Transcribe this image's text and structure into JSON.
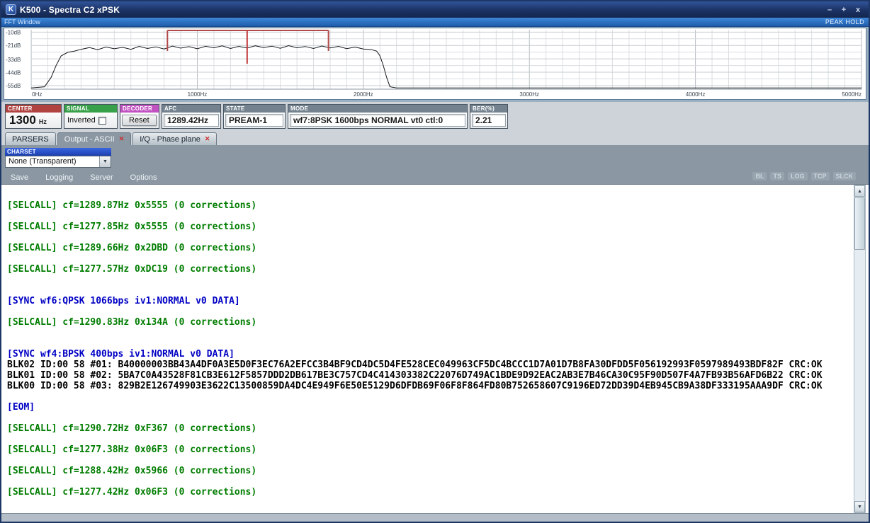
{
  "window": {
    "title": "K500 - Spectra C2 xPSK",
    "icon_letter": "K",
    "buttons": {
      "minimize": "–",
      "maximize": "+",
      "close": "x"
    }
  },
  "icons": {
    "tab_close": "✕",
    "dropdown_arrow": "▼",
    "scroll_up": "▲",
    "scroll_down": "▼"
  },
  "fft": {
    "header": "FFT Window",
    "peak_hold_label": "PEAK HOLD",
    "xlim_hz": [
      0,
      5000
    ],
    "ylim_db": [
      -58,
      -8
    ],
    "y_ticks": [
      [
        -10,
        "-10dB"
      ],
      [
        -21,
        "-21dB"
      ],
      [
        -33,
        "-33dB"
      ],
      [
        -44,
        "-44dB"
      ],
      [
        -55,
        "-55dB"
      ]
    ],
    "x_ticks": [
      [
        0,
        "0Hz"
      ],
      [
        1000,
        "1000Hz"
      ],
      [
        2000,
        "2000Hz"
      ],
      [
        3000,
        "3000Hz"
      ],
      [
        4000,
        "4000Hz"
      ],
      [
        5000,
        "5000Hz"
      ]
    ],
    "markers": {
      "band_start_hz": 820,
      "band_end_hz": 1790,
      "center_hz": 1300,
      "bracket_color": "#b24a4a",
      "center_color": "#c23b3b"
    },
    "spectrum_hz_db": [
      [
        0,
        -57
      ],
      [
        80,
        -56
      ],
      [
        120,
        -48
      ],
      [
        150,
        -38
      ],
      [
        180,
        -30
      ],
      [
        220,
        -27
      ],
      [
        260,
        -26
      ],
      [
        300,
        -24.5
      ],
      [
        350,
        -23
      ],
      [
        400,
        -24.8
      ],
      [
        450,
        -22.5
      ],
      [
        500,
        -24
      ],
      [
        550,
        -22.8
      ],
      [
        600,
        -24.5
      ],
      [
        650,
        -22
      ],
      [
        700,
        -23.8
      ],
      [
        750,
        -22.4
      ],
      [
        800,
        -24.2
      ],
      [
        850,
        -21.8
      ],
      [
        900,
        -23.5
      ],
      [
        950,
        -22.2
      ],
      [
        1000,
        -24
      ],
      [
        1050,
        -21.9
      ],
      [
        1100,
        -23.2
      ],
      [
        1150,
        -21.6
      ],
      [
        1200,
        -23.8
      ],
      [
        1250,
        -22
      ],
      [
        1300,
        -23.4
      ],
      [
        1350,
        -21.5
      ],
      [
        1400,
        -23
      ],
      [
        1450,
        -21.8
      ],
      [
        1500,
        -23.6
      ],
      [
        1550,
        -21.4
      ],
      [
        1600,
        -23.2
      ],
      [
        1650,
        -22.1
      ],
      [
        1700,
        -23.8
      ],
      [
        1750,
        -21.7
      ],
      [
        1800,
        -23.3
      ],
      [
        1850,
        -22
      ],
      [
        1900,
        -23.9
      ],
      [
        1950,
        -22.6
      ],
      [
        2000,
        -24.2
      ],
      [
        2050,
        -24.8
      ],
      [
        2080,
        -26
      ],
      [
        2100,
        -30
      ],
      [
        2120,
        -38
      ],
      [
        2140,
        -48
      ],
      [
        2160,
        -56
      ],
      [
        2200,
        -57
      ],
      [
        2600,
        -57
      ],
      [
        3000,
        -57
      ],
      [
        3400,
        -57
      ],
      [
        3800,
        -57
      ],
      [
        4200,
        -57
      ],
      [
        4600,
        -57
      ],
      [
        5000,
        -57
      ]
    ]
  },
  "controls": {
    "center": {
      "label": "CENTER",
      "value": "1300",
      "unit": "Hz"
    },
    "signal": {
      "label": "SIGNAL",
      "checkbox_label": "Inverted",
      "checked": false
    },
    "decoder": {
      "label": "DECODER",
      "button_label": "Reset"
    },
    "afc": {
      "label": "AFC",
      "value": "1289.42Hz"
    },
    "state": {
      "label": "STATE",
      "value": "PREAM-1"
    },
    "mode": {
      "label": "MODE",
      "value": "wf7:8PSK 1600bps NORMAL vt0 ctl:0"
    },
    "ber": {
      "label": "BER(%)",
      "value": "2.21"
    }
  },
  "tabs": [
    {
      "label": "PARSERS",
      "closable": false,
      "active": false
    },
    {
      "label": "Output - ASCII",
      "closable": true,
      "active": true
    },
    {
      "label": "I/Q - Phase plane",
      "closable": true,
      "active": false
    }
  ],
  "charset": {
    "label": "CHARSET",
    "selected": "None (Transparent)"
  },
  "menu": {
    "items": [
      "Save",
      "Logging",
      "Server",
      "Options"
    ]
  },
  "status_flags": [
    "BL",
    "TS",
    "LOG",
    "TCP",
    "SLCK"
  ],
  "output": {
    "lines": [
      {
        "text": "[SELCALL] cf=1289.87Hz 0x5555 (0 corrections)",
        "color": "green"
      },
      {
        "text": "",
        "color": "black"
      },
      {
        "text": "[SELCALL] cf=1277.85Hz 0x5555 (0 corrections)",
        "color": "green"
      },
      {
        "text": "",
        "color": "black"
      },
      {
        "text": "[SELCALL] cf=1289.66Hz 0x2DBD (0 corrections)",
        "color": "green"
      },
      {
        "text": "",
        "color": "black"
      },
      {
        "text": "[SELCALL] cf=1277.57Hz 0xDC19 (0 corrections)",
        "color": "green"
      },
      {
        "text": "",
        "color": "black"
      },
      {
        "text": "",
        "color": "black"
      },
      {
        "text": "[SYNC wf6:QPSK 1066bps iv1:NORMAL v0 DATA]",
        "color": "blue"
      },
      {
        "text": "",
        "color": "black"
      },
      {
        "text": "[SELCALL] cf=1290.83Hz 0x134A (0 corrections)",
        "color": "green"
      },
      {
        "text": "",
        "color": "black"
      },
      {
        "text": "",
        "color": "black"
      },
      {
        "text": "[SYNC wf4:BPSK 400bps iv1:NORMAL v0 DATA]",
        "color": "blue"
      },
      {
        "text": "BLK02 ID:00 58 #01: B40000003BB43A4DF0A3E5D0F3EC76A2EFCC3B4BF9CD4DC5D4FE528CEC049963CF5DC4BCCC1D7A01D7B8FA30DFDD5F056192993F0597989493BDF82F CRC:OK",
        "color": "black"
      },
      {
        "text": "BLK01 ID:00 58 #02: 5BA7C0A43528F81CB3E612F5857DDD2DB617BE3C757CD4C414303382C22076D749AC1BDE9D92EAC2AB3E7B46CA30C95F90D507F4A7FB93B56AFD6B22 CRC:OK",
        "color": "black"
      },
      {
        "text": "BLK00 ID:00 58 #03: 829B2E126749903E3622C13500859DA4DC4E949F6E50E5129D6DFDB69F06F8F864FD80B752658607C9196ED72DD39D4EB945CB9A38DF333195AAA9DF CRC:OK",
        "color": "black"
      },
      {
        "text": "",
        "color": "black"
      },
      {
        "text": "[EOM]",
        "color": "blue"
      },
      {
        "text": "",
        "color": "black"
      },
      {
        "text": "[SELCALL] cf=1290.72Hz 0xF367 (0 corrections)",
        "color": "green"
      },
      {
        "text": "",
        "color": "black"
      },
      {
        "text": "[SELCALL] cf=1277.38Hz 0x06F3 (0 corrections)",
        "color": "green"
      },
      {
        "text": "",
        "color": "black"
      },
      {
        "text": "[SELCALL] cf=1288.42Hz 0x5966 (0 corrections)",
        "color": "green"
      },
      {
        "text": "",
        "color": "black"
      },
      {
        "text": "[SELCALL] cf=1277.42Hz 0x06F3 (0 corrections)",
        "color": "green"
      }
    ]
  }
}
